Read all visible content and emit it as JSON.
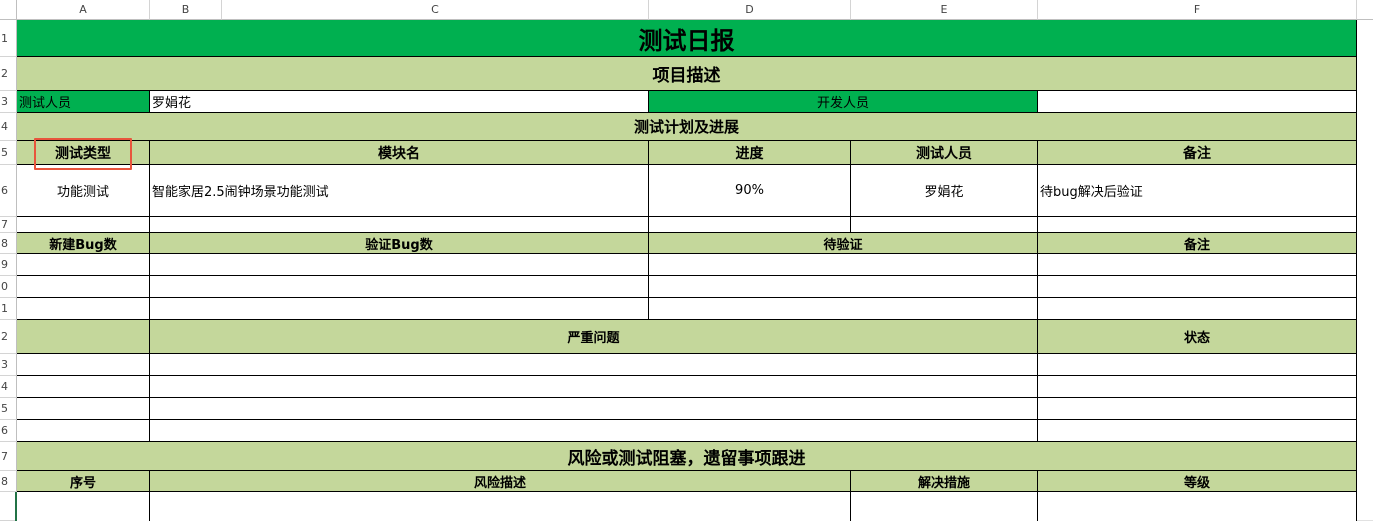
{
  "columns": [
    "A",
    "B",
    "C",
    "D",
    "E",
    "F"
  ],
  "rows": [
    "1",
    "2",
    "3",
    "4",
    "5",
    "6",
    "7",
    "8",
    "9",
    "0",
    "1",
    "2",
    "3",
    "4",
    "5",
    "6",
    "7",
    "8"
  ],
  "sheet": {
    "title": "测试日报",
    "project_section": "项目描述",
    "tester_label": "测试人员",
    "tester_value": "罗娟花",
    "developer_label": "开发人员",
    "developer_value": "",
    "plan_section": "测试计划及进展",
    "plan_headers": [
      "测试类型",
      "模块名",
      "进度",
      "测试人员",
      "备注"
    ],
    "plan_row": {
      "type": "功能测试",
      "module": "智能家居2.5闹钟场景功能测试",
      "progress": "90%",
      "tester": "罗娟花",
      "note": "待bug解决后验证"
    },
    "bug_headers": [
      "新建Bug数",
      "验证Bug数",
      "待验证",
      "备注"
    ],
    "issue_headers": [
      "严重问题",
      "状态"
    ],
    "risk_section": "风险或测试阻塞，遗留事项跟进",
    "risk_headers": [
      "序号",
      "风险描述",
      "解决措施",
      "等级"
    ]
  },
  "colors": {
    "title_green": "#00b050",
    "header_light_green": "#c4d79b",
    "selection_outline": "#e8553d"
  }
}
